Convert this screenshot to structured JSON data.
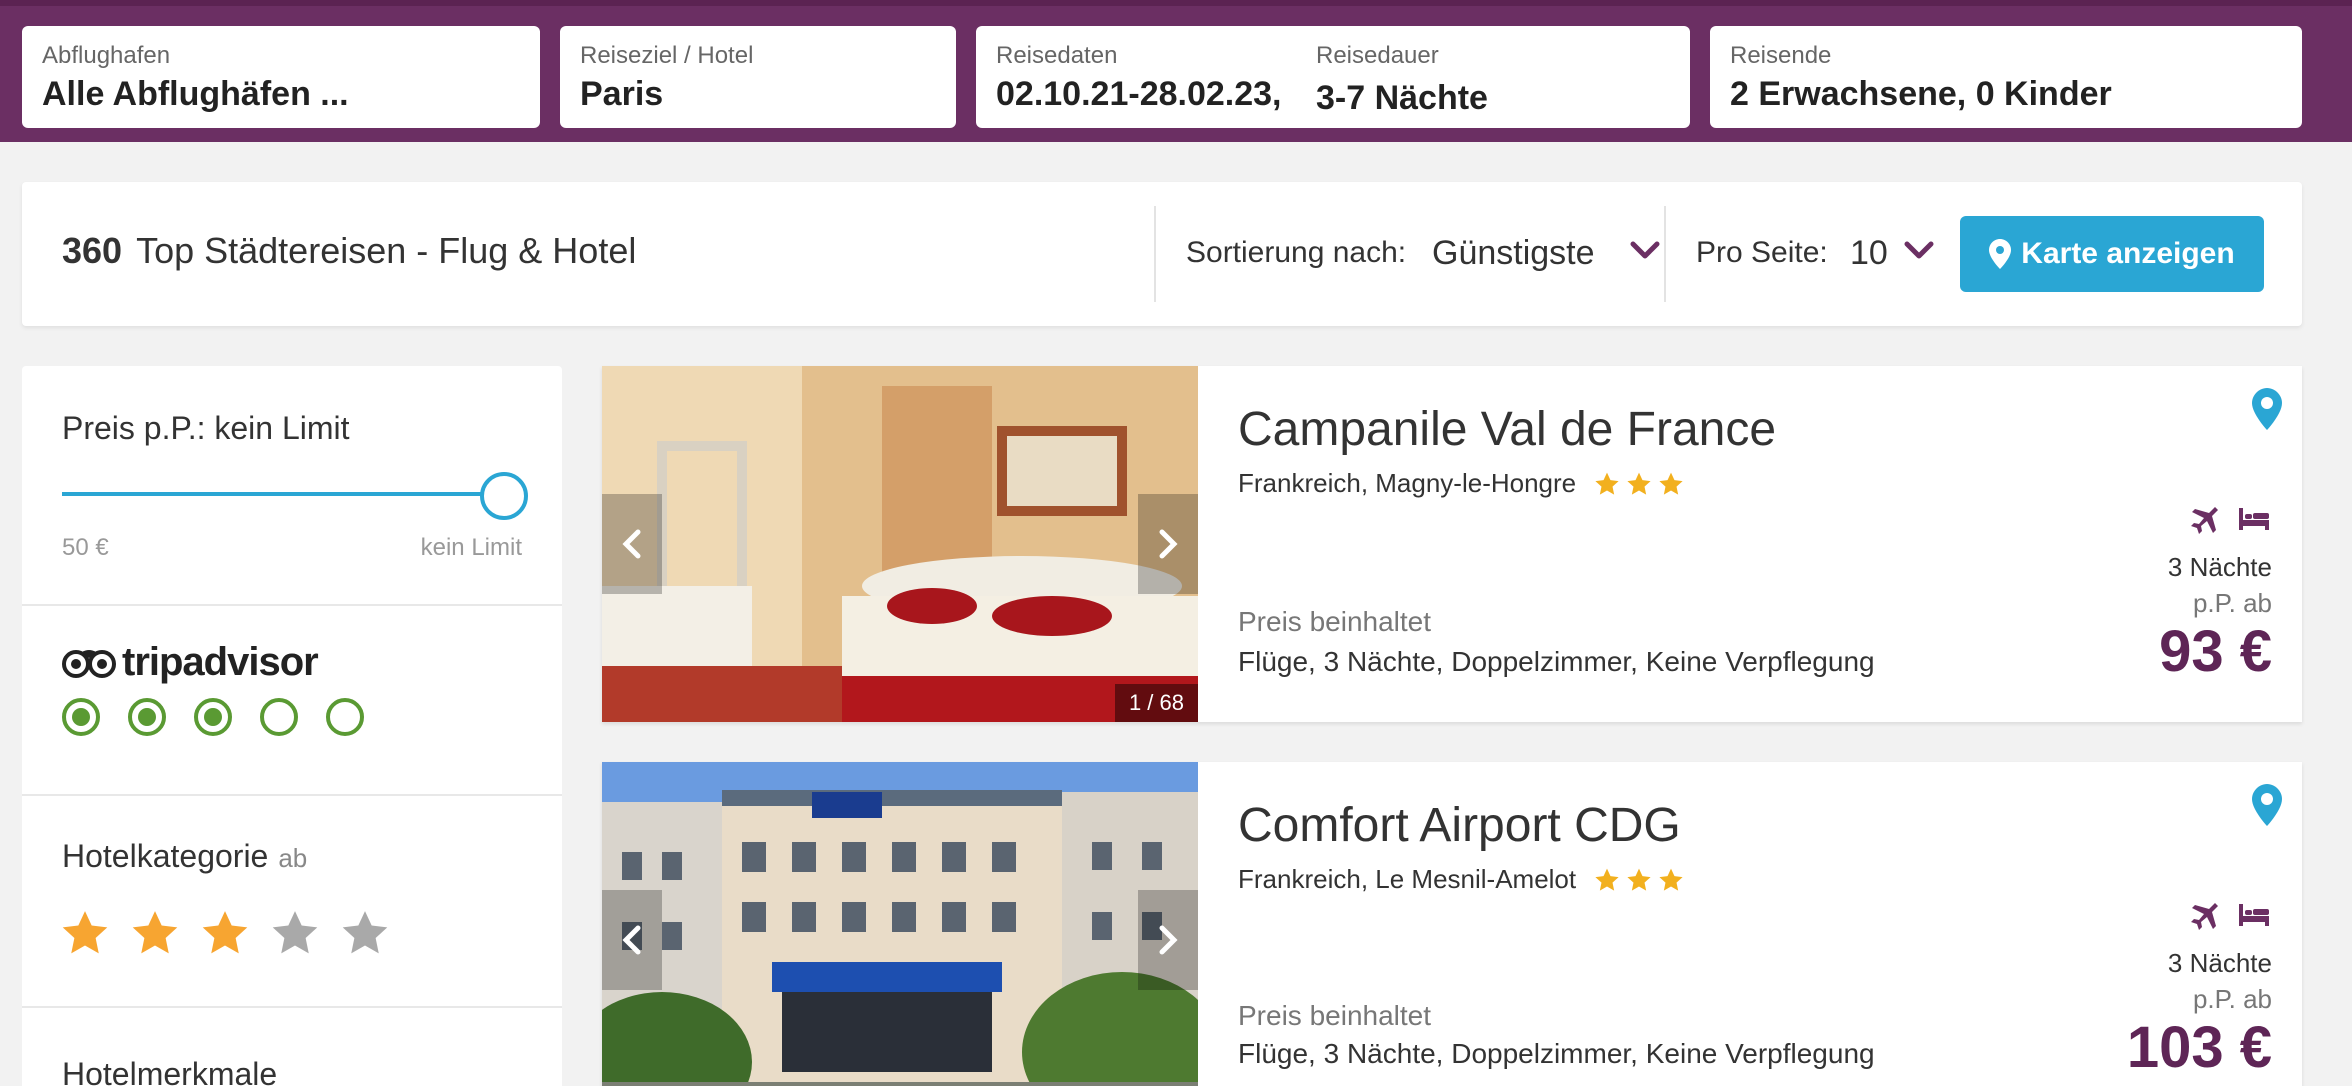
{
  "search": {
    "airport": {
      "label": "Abflughafen",
      "value": "Alle Abflughäfen ..."
    },
    "destination": {
      "label": "Reiseziel / Hotel",
      "value": "Paris"
    },
    "dates": {
      "label": "Reisedaten",
      "from": "02.10.21",
      "sep": "-",
      "to": "28.02.23,"
    },
    "duration": {
      "label": "Reisedauer",
      "value": "3-7 Nächte"
    },
    "travelers": {
      "label": "Reisende",
      "adults": "2 Erwachsene,",
      "children": "0 Kinder"
    }
  },
  "results": {
    "count": "360",
    "title": "Top Städtereisen - Flug & Hotel",
    "sort_label": "Sortierung nach:",
    "sort_value": "Günstigste",
    "per_page_label": "Pro Seite:",
    "per_page_value": "10",
    "map_button": "Karte anzeigen"
  },
  "filters": {
    "price_label": "Preis p.P.: kein Limit",
    "price_min": "50 €",
    "price_max": "kein Limit",
    "tripadvisor_logo": "tripadvisor",
    "tripadvisor_rating": 3,
    "tripadvisor_max": 5,
    "category_label": "Hotelkategorie",
    "category_suffix": "ab",
    "category_stars": 3,
    "features_label": "Hotelmerkmale"
  },
  "hotels": [
    {
      "name": "Campanile Val de France",
      "location": "Frankreich, Magny-le-Hongre",
      "stars": 3,
      "photo_counter": "1 / 68",
      "includes_label": "Preis beinhaltet",
      "includes": "Flüge, 3 Nächte, Doppelzimmer, Keine Verpflegung",
      "nights": "3 Nächte",
      "price_prefix": "p.P. ab",
      "price": "93 €"
    },
    {
      "name": "Comfort Airport CDG",
      "location": "Frankreich, Le Mesnil-Amelot",
      "stars": 3,
      "includes_label": "Preis beinhaltet",
      "includes": "Flüge, 3 Nächte, Doppelzimmer, Keine Verpflegung",
      "nights": "3 Nächte",
      "price_prefix": "p.P. ab",
      "price": "103 €"
    }
  ],
  "colors": {
    "brand": "#6b2f63",
    "accent": "#2aa6d4",
    "price": "#5e2556",
    "star": "#f2b01e",
    "tripadvisor_green": "#5a9a33"
  }
}
